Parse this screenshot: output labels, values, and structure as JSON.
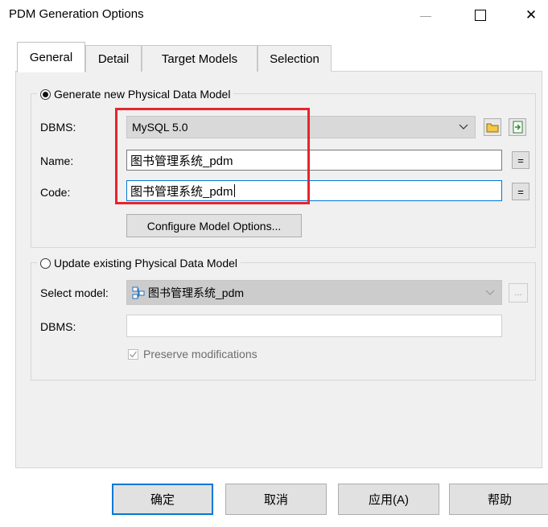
{
  "window": {
    "title": "PDM Generation Options",
    "minimize": "—",
    "close": "✕"
  },
  "tabs": [
    {
      "label": "General"
    },
    {
      "label": "Detail"
    },
    {
      "label": "Target Models"
    },
    {
      "label": "Selection"
    }
  ],
  "generate_group": {
    "label": "Generate new Physical Data Model",
    "selected": true,
    "dbms_label": "DBMS:",
    "dbms_value": "MySQL 5.0",
    "name_label": "Name:",
    "name_value": "图书管理系统_pdm",
    "code_label": "Code:",
    "code_value": "图书管理系统_pdm",
    "eq_label": "=",
    "configure_button": "Configure Model Options..."
  },
  "update_group": {
    "label": "Update existing Physical Data Model",
    "selected": false,
    "select_model_label": "Select model:",
    "select_model_value": "图书管理系统_pdm",
    "ellipsis": "...",
    "dbms_label": "DBMS:",
    "dbms_value": "",
    "preserve_label": "Preserve modifications",
    "preserve_checked": true
  },
  "footer": {
    "ok": "确定",
    "cancel": "取消",
    "apply": "应用(A)",
    "help": "帮助"
  },
  "colors": {
    "highlight": "#e8242c",
    "focus": "#0078d7"
  }
}
